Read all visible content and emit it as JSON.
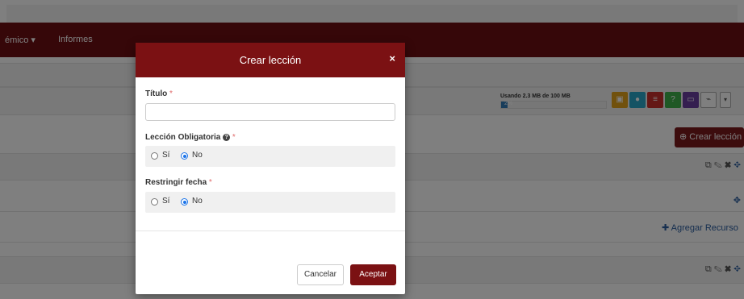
{
  "navbar": {
    "menu_1": "émico ▾",
    "menu_2": "Informes"
  },
  "storage": {
    "label": "Usando 2.3 MB de 100 MB",
    "percent_text": "2%",
    "percent": 2
  },
  "toolbar_icons": [
    "briefcase-icon",
    "chat-icon",
    "list-icon",
    "help-icon",
    "monitor-icon",
    "chart-icon",
    "chevron-down-icon"
  ],
  "page": {
    "crear_leccion": "Crear lección",
    "agregar_recurso": "Agregar Recurso"
  },
  "modal": {
    "title": "Crear lección",
    "close": "×",
    "titulo_label": "Título",
    "titulo_value": "",
    "obligatoria_label": "Lección Obligatoria",
    "restringir_label": "Restringir fecha",
    "required_mark": "*",
    "option_si": "Sí",
    "option_no": "No",
    "obligatoria_selected": "No",
    "restringir_selected": "No",
    "cancel": "Cancelar",
    "accept": "Aceptar"
  },
  "colors": {
    "brand": "#7b1113",
    "navbar": "#6d0f12",
    "link": "#2a5d9f"
  }
}
